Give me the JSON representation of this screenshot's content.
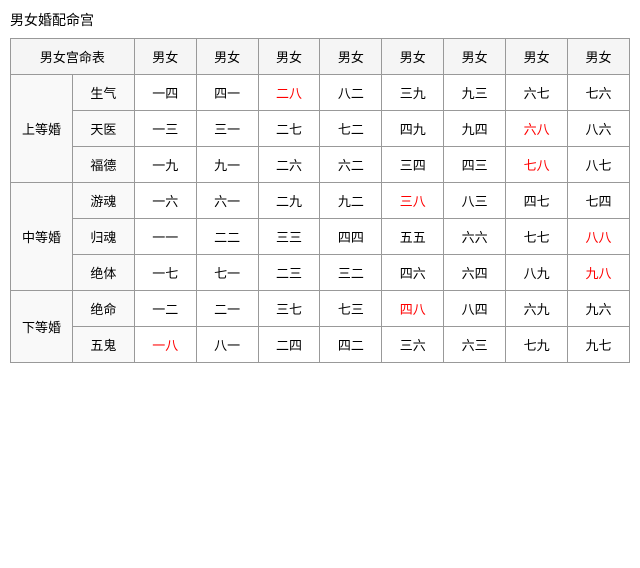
{
  "title": "男女婚配命宫",
  "table": {
    "header": {
      "col0": "男女宫命表",
      "cols": [
        "男女",
        "男女",
        "男女",
        "男女",
        "男女",
        "男女",
        "男女",
        "男女"
      ]
    },
    "groups": [
      {
        "group_label": "上等婚",
        "rows": [
          {
            "row_label": "生气",
            "cells": [
              {
                "text": "一四",
                "red": false
              },
              {
                "text": "四一",
                "red": false
              },
              {
                "text": "二八",
                "red": true
              },
              {
                "text": "八二",
                "red": false
              },
              {
                "text": "三九",
                "red": false
              },
              {
                "text": "九三",
                "red": false
              },
              {
                "text": "六七",
                "red": false
              },
              {
                "text": "七六",
                "red": false
              }
            ]
          },
          {
            "row_label": "天医",
            "cells": [
              {
                "text": "一三",
                "red": false
              },
              {
                "text": "三一",
                "red": false
              },
              {
                "text": "二七",
                "red": false
              },
              {
                "text": "七二",
                "red": false
              },
              {
                "text": "四九",
                "red": false
              },
              {
                "text": "九四",
                "red": false
              },
              {
                "text": "六八",
                "red": true
              },
              {
                "text": "八六",
                "red": false
              }
            ]
          },
          {
            "row_label": "福德",
            "cells": [
              {
                "text": "一九",
                "red": false
              },
              {
                "text": "九一",
                "red": false
              },
              {
                "text": "二六",
                "red": false
              },
              {
                "text": "六二",
                "red": false
              },
              {
                "text": "三四",
                "red": false
              },
              {
                "text": "四三",
                "red": false
              },
              {
                "text": "七八",
                "red": true
              },
              {
                "text": "八七",
                "red": false
              }
            ]
          }
        ]
      },
      {
        "group_label": "中等婚",
        "rows": [
          {
            "row_label": "游魂",
            "cells": [
              {
                "text": "一六",
                "red": false
              },
              {
                "text": "六一",
                "red": false
              },
              {
                "text": "二九",
                "red": false
              },
              {
                "text": "九二",
                "red": false
              },
              {
                "text": "三八",
                "red": true
              },
              {
                "text": "八三",
                "red": false
              },
              {
                "text": "四七",
                "red": false
              },
              {
                "text": "七四",
                "red": false
              }
            ]
          },
          {
            "row_label": "归魂",
            "cells": [
              {
                "text": "一一",
                "red": false
              },
              {
                "text": "二二",
                "red": false
              },
              {
                "text": "三三",
                "red": false
              },
              {
                "text": "四四",
                "red": false
              },
              {
                "text": "五五",
                "red": false
              },
              {
                "text": "六六",
                "red": false
              },
              {
                "text": "七七",
                "red": false
              },
              {
                "text": "八八",
                "red": true
              }
            ]
          },
          {
            "row_label": "绝体",
            "cells": [
              {
                "text": "一七",
                "red": false
              },
              {
                "text": "七一",
                "red": false
              },
              {
                "text": "二三",
                "red": false
              },
              {
                "text": "三二",
                "red": false
              },
              {
                "text": "四六",
                "red": false
              },
              {
                "text": "六四",
                "red": false
              },
              {
                "text": "八九",
                "red": false
              },
              {
                "text": "九八",
                "red": true
              }
            ]
          }
        ]
      },
      {
        "group_label": "下等婚",
        "rows": [
          {
            "row_label": "绝命",
            "cells": [
              {
                "text": "一二",
                "red": false
              },
              {
                "text": "二一",
                "red": false
              },
              {
                "text": "三七",
                "red": false
              },
              {
                "text": "七三",
                "red": false
              },
              {
                "text": "四八",
                "red": true
              },
              {
                "text": "八四",
                "red": false
              },
              {
                "text": "六九",
                "red": false
              },
              {
                "text": "九六",
                "red": false
              }
            ]
          },
          {
            "row_label": "五鬼",
            "cells": [
              {
                "text": "一八",
                "red": true
              },
              {
                "text": "八一",
                "red": false
              },
              {
                "text": "二四",
                "red": false
              },
              {
                "text": "四二",
                "red": false
              },
              {
                "text": "三六",
                "red": false
              },
              {
                "text": "六三",
                "red": false
              },
              {
                "text": "七九",
                "red": false
              },
              {
                "text": "九七",
                "red": false
              }
            ]
          }
        ]
      }
    ]
  }
}
